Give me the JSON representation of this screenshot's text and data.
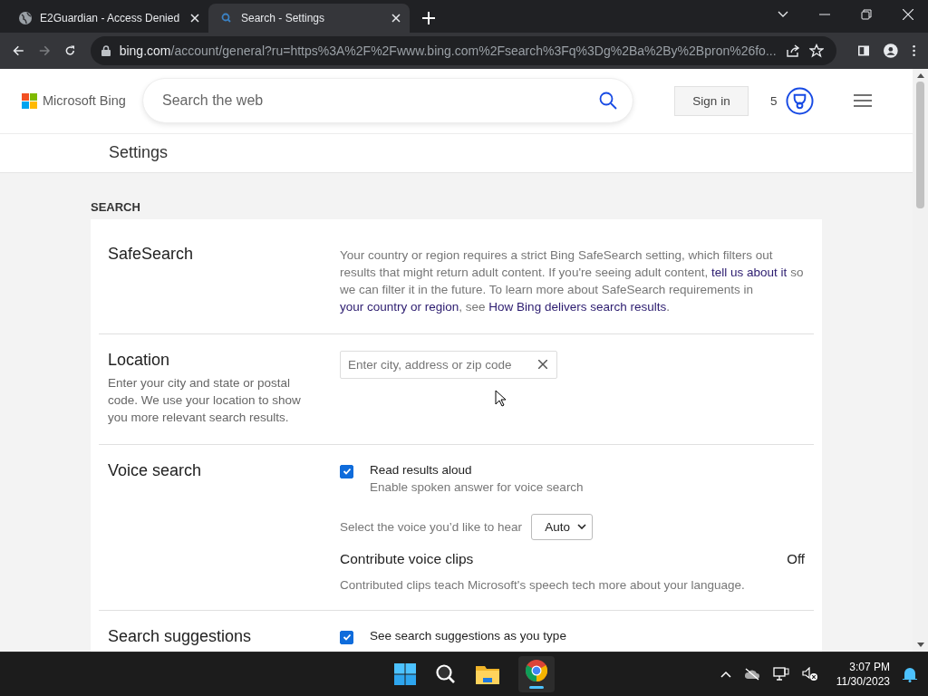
{
  "tabs": [
    {
      "title": "E2Guardian - Access Denied",
      "selected": false
    },
    {
      "title": "Search - Settings",
      "selected": true
    }
  ],
  "address_bar": {
    "domain": "bing.com",
    "path": "/account/general?ru=https%3A%2F%2Fwww.bing.com%2Fsearch%3Fq%3Dg%2Ba%2By%2Bpron%26fo..."
  },
  "header": {
    "logo_text": "Microsoft Bing",
    "search_placeholder": "Search the web",
    "sign_in": "Sign in",
    "points": "5"
  },
  "settings_title": "Settings",
  "section_title": "SEARCH",
  "rows": [
    {
      "title": "SafeSearch",
      "controls": [
        {
          "kind": "paragraph",
          "parts": [
            {
              "kind": "text",
              "text": "Your country or region requires a strict Bing SafeSearch setting, which filters out results that might return adult content. If you're seeing adult content, "
            },
            {
              "kind": "link",
              "text": "tell us about it"
            },
            {
              "kind": "text",
              "text": " so we can filter it in the future. To learn more about SafeSearch requirements in "
            },
            {
              "kind": "link",
              "text": "your country or region"
            },
            {
              "kind": "text",
              "text": ", see "
            },
            {
              "kind": "link",
              "text": "How Bing delivers search results"
            },
            {
              "kind": "text",
              "text": "."
            }
          ]
        }
      ]
    },
    {
      "title": "Location",
      "description": "Enter your city and state or postal code. We use your location to show you more relevant search results.",
      "controls": [
        {
          "kind": "text-field",
          "placeholder": "Enter city, address or zip code"
        }
      ]
    },
    {
      "title": "Voice search",
      "controls": [
        {
          "kind": "checkbox",
          "label": "Read results aloud",
          "sublabel": "Enable spoken answer for voice search",
          "checked": true
        },
        {
          "kind": "select",
          "label": "Select the voice you’d like to hear",
          "value": "Auto"
        },
        {
          "kind": "status",
          "label": "Contribute voice clips",
          "status": "Off",
          "description": "Contributed clips teach Microsoft's speech tech more about your language."
        }
      ]
    },
    {
      "title": "Search suggestions",
      "controls": [
        {
          "kind": "checkbox",
          "label": "See search suggestions as you type",
          "checked": true
        }
      ]
    }
  ],
  "taskbar": {
    "time": "3:07 PM",
    "date": "11/30/2023"
  }
}
